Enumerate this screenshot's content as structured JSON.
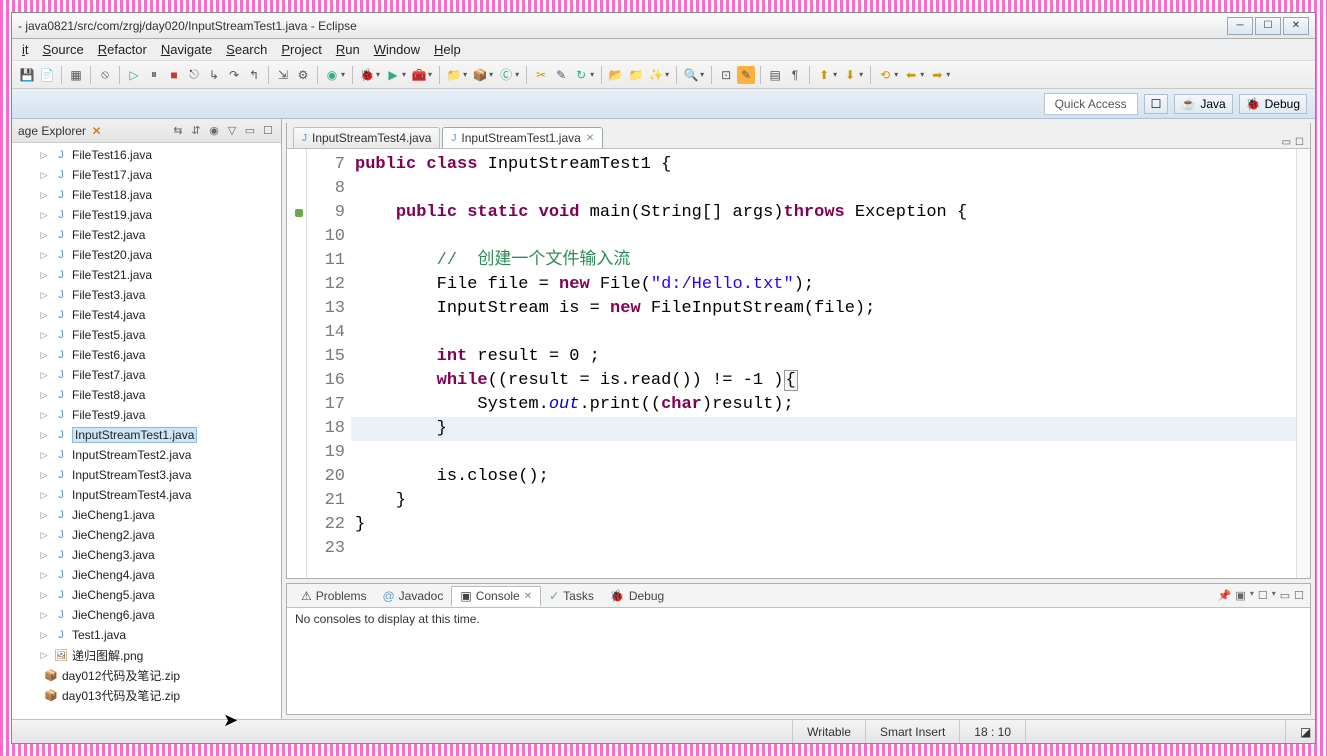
{
  "window": {
    "title": "- java0821/src/com/zrgj/day020/InputStreamTest1.java - Eclipse"
  },
  "menu": [
    "it",
    "Source",
    "Refactor",
    "Navigate",
    "Search",
    "Project",
    "Run",
    "Window",
    "Help"
  ],
  "perspective": {
    "quick_access": "Quick Access",
    "java": "Java",
    "debug": "Debug"
  },
  "explorer": {
    "title": "age Explorer",
    "items": [
      {
        "label": "FileTest16.java",
        "type": "j"
      },
      {
        "label": "FileTest17.java",
        "type": "j"
      },
      {
        "label": "FileTest18.java",
        "type": "j"
      },
      {
        "label": "FileTest19.java",
        "type": "j"
      },
      {
        "label": "FileTest2.java",
        "type": "j"
      },
      {
        "label": "FileTest20.java",
        "type": "j"
      },
      {
        "label": "FileTest21.java",
        "type": "j"
      },
      {
        "label": "FileTest3.java",
        "type": "j"
      },
      {
        "label": "FileTest4.java",
        "type": "j"
      },
      {
        "label": "FileTest5.java",
        "type": "j"
      },
      {
        "label": "FileTest6.java",
        "type": "j"
      },
      {
        "label": "FileTest7.java",
        "type": "j"
      },
      {
        "label": "FileTest8.java",
        "type": "j"
      },
      {
        "label": "FileTest9.java",
        "type": "j"
      },
      {
        "label": "InputStreamTest1.java",
        "type": "j",
        "selected": true
      },
      {
        "label": "InputStreamTest2.java",
        "type": "j"
      },
      {
        "label": "InputStreamTest3.java",
        "type": "j"
      },
      {
        "label": "InputStreamTest4.java",
        "type": "j"
      },
      {
        "label": "JieCheng1.java",
        "type": "j"
      },
      {
        "label": "JieCheng2.java",
        "type": "j"
      },
      {
        "label": "JieCheng3.java",
        "type": "j"
      },
      {
        "label": "JieCheng4.java",
        "type": "j"
      },
      {
        "label": "JieCheng5.java",
        "type": "j"
      },
      {
        "label": "JieCheng6.java",
        "type": "j"
      },
      {
        "label": "Test1.java",
        "type": "j"
      },
      {
        "label": "递归图解.png",
        "type": "img"
      },
      {
        "label": "day012代码及笔记.zip",
        "type": "zip"
      },
      {
        "label": "day013代码及笔记.zip",
        "type": "zip"
      }
    ]
  },
  "editor": {
    "tabs": [
      {
        "label": "InputStreamTest4.java",
        "active": false
      },
      {
        "label": "InputStreamTest1.java",
        "active": true
      }
    ],
    "lines": [
      {
        "n": 7,
        "html": "<span class='kw'>public</span> <span class='kw'>class</span> InputStreamTest1 {"
      },
      {
        "n": 8,
        "html": ""
      },
      {
        "n": 9,
        "html": "    <span class='kw'>public</span> <span class='kw'>static</span> <span class='kw'>void</span> main(String[] args)<span class='kw'>throws</span> Exception {",
        "marker": true
      },
      {
        "n": 10,
        "html": ""
      },
      {
        "n": 11,
        "html": "        <span class='cm'>//  </span><span class='cm-zh'>创建一个文件输入流</span>"
      },
      {
        "n": 12,
        "html": "        File file = <span class='kw'>new</span> File(<span class='st'>\"d:/Hello.txt\"</span>);"
      },
      {
        "n": 13,
        "html": "        InputStream is = <span class='kw'>new</span> FileInputStream(file);"
      },
      {
        "n": 14,
        "html": ""
      },
      {
        "n": 15,
        "html": "        <span class='kw'>int</span> result = 0 ;"
      },
      {
        "n": 16,
        "html": "        <span class='kw'>while</span>((result = is.read()) != -1 )<span class='box'>{</span>"
      },
      {
        "n": 17,
        "html": "            System.<span class='fld'>out</span>.print((<span class='kw'>char</span>)result);"
      },
      {
        "n": 18,
        "html": "        }",
        "hl": true
      },
      {
        "n": 19,
        "html": ""
      },
      {
        "n": 20,
        "html": "        is.close();"
      },
      {
        "n": 21,
        "html": "    }"
      },
      {
        "n": 22,
        "html": "}"
      },
      {
        "n": 23,
        "html": ""
      }
    ]
  },
  "console": {
    "tabs": [
      "Problems",
      "Javadoc",
      "Console",
      "Tasks",
      "Debug"
    ],
    "active": 2,
    "message": "No consoles to display at this time."
  },
  "status": {
    "writable": "Writable",
    "insert": "Smart Insert",
    "pos": "18 : 10"
  }
}
